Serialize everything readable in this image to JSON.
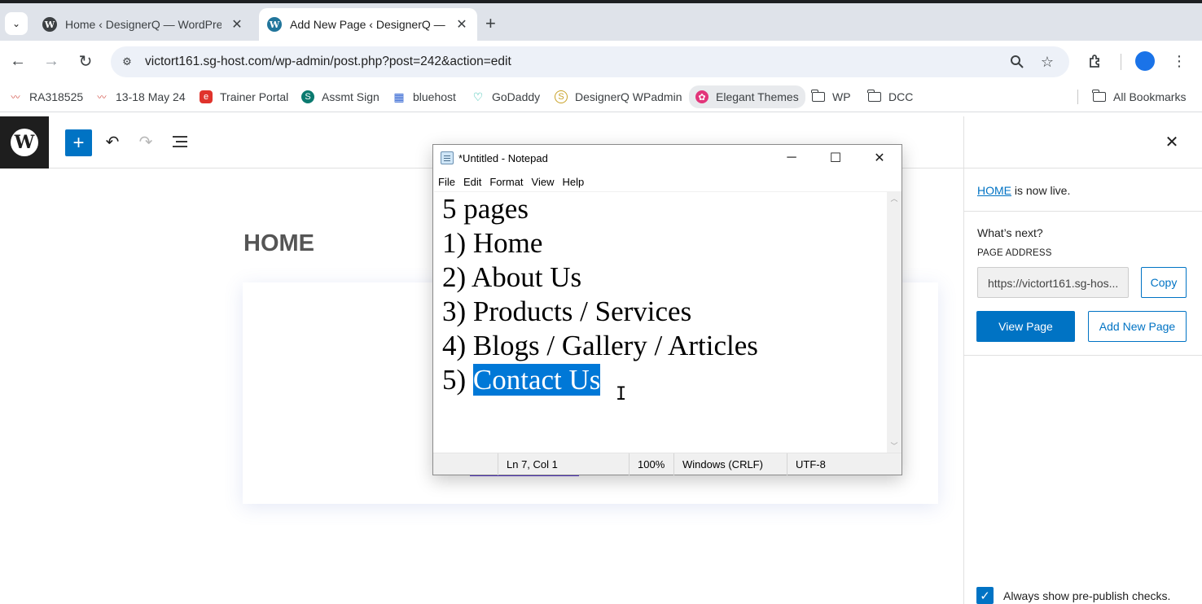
{
  "browser": {
    "tabs": [
      {
        "title": "Home ‹ DesignerQ — WordPress",
        "active": false
      },
      {
        "title": "Add New Page ‹ DesignerQ — WordPress",
        "active": true
      }
    ],
    "url": "victort161.sg-host.com/wp-admin/post.php?post=242&action=edit",
    "bookmarks": [
      {
        "label": "RA318525",
        "icon": "chart-line-icon"
      },
      {
        "label": "13-18 May 24",
        "icon": "chart-line-icon"
      },
      {
        "label": "Trainer Portal",
        "icon": "trainer-portal-icon"
      },
      {
        "label": "Assmt Sign",
        "icon": "sharepoint-icon"
      },
      {
        "label": "bluehost",
        "icon": "grid-icon"
      },
      {
        "label": "GoDaddy",
        "icon": "godaddy-icon"
      },
      {
        "label": "DesignerQ WPadmin",
        "icon": "coin-icon"
      },
      {
        "label": "Elegant Themes",
        "icon": "elegant-themes-icon"
      },
      {
        "label": "WP",
        "icon": "folder-icon"
      },
      {
        "label": "DCC",
        "icon": "folder-icon"
      }
    ],
    "all_bookmarks": "All Bookmarks"
  },
  "editor": {
    "page_heading": "HOME"
  },
  "publish_panel": {
    "live_link": "HOME",
    "live_suffix": " is now live.",
    "whats_next": "What’s next?",
    "page_address_label": "PAGE ADDRESS",
    "page_address_value": "https://victort161.sg-hos...",
    "copy_label": "Copy",
    "view_page_label": "View Page",
    "add_new_page_label": "Add New Page",
    "prepublish_label": "Always show pre-publish checks."
  },
  "notepad": {
    "title": "*Untitled - Notepad",
    "menu": [
      "File",
      "Edit",
      "Format",
      "View",
      "Help"
    ],
    "lines": [
      "5 pages",
      "1) Home",
      "2) About Us",
      "3) Products / Services",
      "4) Blogs / Gallery / Articles"
    ],
    "last_line_prefix": "5) ",
    "last_line_selected": "Contact Us",
    "status": {
      "position": "Ln 7, Col 1",
      "zoom": "100%",
      "line_endings": "Windows (CRLF)",
      "encoding": "UTF-8"
    }
  },
  "colors": {
    "wp_blue": "#0073c4",
    "selection": "#0078d7",
    "tab_strip": "#dfe3ea"
  }
}
